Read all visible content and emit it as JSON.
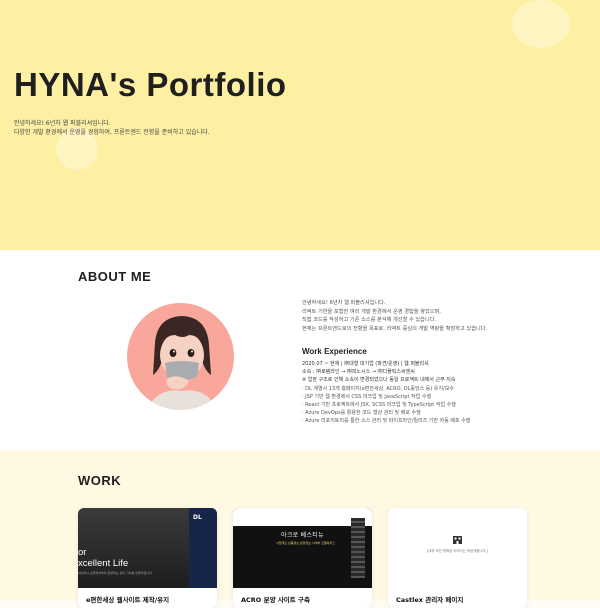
{
  "hero": {
    "title": "HYNA's Portfolio",
    "lines": [
      "안녕하세요! 6년차 웹 퍼블리셔입니다.",
      "다양한 개발 환경에서 운영을 경험하여, 프론트엔드 전향을 준비하고 있습니다."
    ]
  },
  "about": {
    "title": "ABOUT ME",
    "intro": [
      "안녕하세요! 6년차 웹 퍼블리셔입니다.",
      "리액트 기반을 포함한 여러 개발 환경에서 운영 경험을 쌓았으며,",
      "직접 코드를 작성하고 기존 소스를 분석해 개선할 수 있습니다.",
      "현재는 프론트엔드로의 전향을 목표로, 리액트 중심의 개발 역량을 확장하고 있습니다."
    ],
    "work_experience": {
      "title": "Work Experience",
      "period": "2020.07 ~ 현재 | ㈜대형 대기업 (파견/운영) | 웹 퍼블리셔",
      "company": "소속 : ㈜로템라인 → ㈜피노시스 → ㈜디플릭스씨엔씨",
      "note": "※ 업장 구조로 인해 소속이 변경되었으나 동일 프로젝트 내에서 근무 지속",
      "items": [
        "· DL 계열사 13개 홈페이지(e편한세상, ACRO, DL홀딩스 등) 유지/보수",
        "· JSP 기반 웹 환경에서 CSS 마크업 및 JavaScript 작업 수행",
        "· React 기반 프로젝트에서 JSX, SCSS 마크업 및 TypeScript 작업 수행",
        "· Azure DevOps를 활용한 코드 형상 관리 및 배포 수행",
        "· Azure 리포지토리를 통한 소스 관리 및 파이프라인/릴리즈 기반 자동 배포 수행"
      ]
    }
  },
  "work": {
    "title": "WORK",
    "cards": [
      {
        "title": "e편한세상 웹사이트 제작/유지",
        "thumb_text_1": "or",
        "thumb_text_2": "xcellent Life",
        "thumb_small": "하나하나 손끝에서부터 완성되는 삶의 가치를 만들어갑니다",
        "thumb_logo": "DL"
      },
      {
        "title": "ACRO 분양 사이트 구축",
        "thumb_label": "아크로 베스티뉴",
        "thumb_tags": "사업개요   상품정보   분양정보   사이버 모델하우스"
      },
      {
        "title": "Castlex 관리자 페이지",
        "thumb_message": "[내부 보안 정책상 이미지는 비공개합니다.]"
      }
    ]
  },
  "colors": {
    "hero_bg": "#fdf0a3",
    "about_bg": "#ffffff",
    "work_bg": "#fff8e2",
    "avatar_bg": "#f8a79a"
  }
}
